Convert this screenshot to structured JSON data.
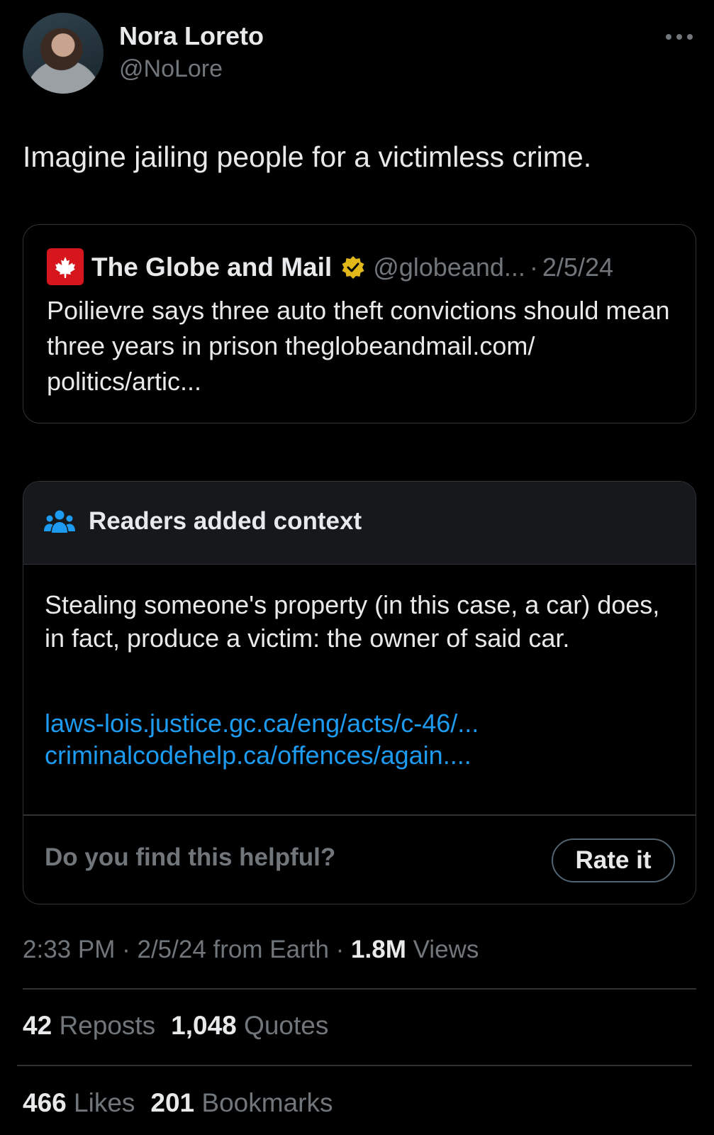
{
  "author": {
    "display_name": "Nora Loreto",
    "handle": "@NoLore"
  },
  "tweet": {
    "text": "Imagine jailing people for a victimless crime."
  },
  "quoted": {
    "name": "The Globe and Mail",
    "handle": "@globeand...",
    "sep": "·",
    "date": "2/5/24",
    "text": "Poilievre says three auto theft convictions should mean three years in prison theglobeandmail.com/ politics/artic..."
  },
  "note": {
    "title": "Readers added context",
    "text": "Stealing someone's property (in this case, a car) does, in fact, produce a victim: the owner of said car.",
    "links": [
      "laws-lois.justice.gc.ca/eng/acts/c-46/...",
      "criminalcodehelp.ca/offences/again...."
    ],
    "question": "Do you find this helpful?",
    "rate_label": "Rate it"
  },
  "meta": {
    "time": "2:33 PM",
    "sep1": "·",
    "date": "2/5/24",
    "from": "from Earth",
    "sep2": "·",
    "views_count": "1.8M",
    "views_label": "Views"
  },
  "stats": {
    "reposts_count": "42",
    "reposts_label": "Reposts",
    "quotes_count": "1,048",
    "quotes_label": "Quotes",
    "likes_count": "466",
    "likes_label": "Likes",
    "bookmarks_count": "201",
    "bookmarks_label": "Bookmarks"
  },
  "colors": {
    "background": "#000000",
    "text": "#e7e9ea",
    "secondary": "#71767b",
    "link": "#1d9bf0",
    "border": "#2f3336",
    "globe_red": "#d6151c",
    "verified_gold": "#e2b719"
  },
  "icons": [
    "avatar",
    "more-icon",
    "maple-leaf-icon",
    "verified-icon",
    "people-icon"
  ]
}
